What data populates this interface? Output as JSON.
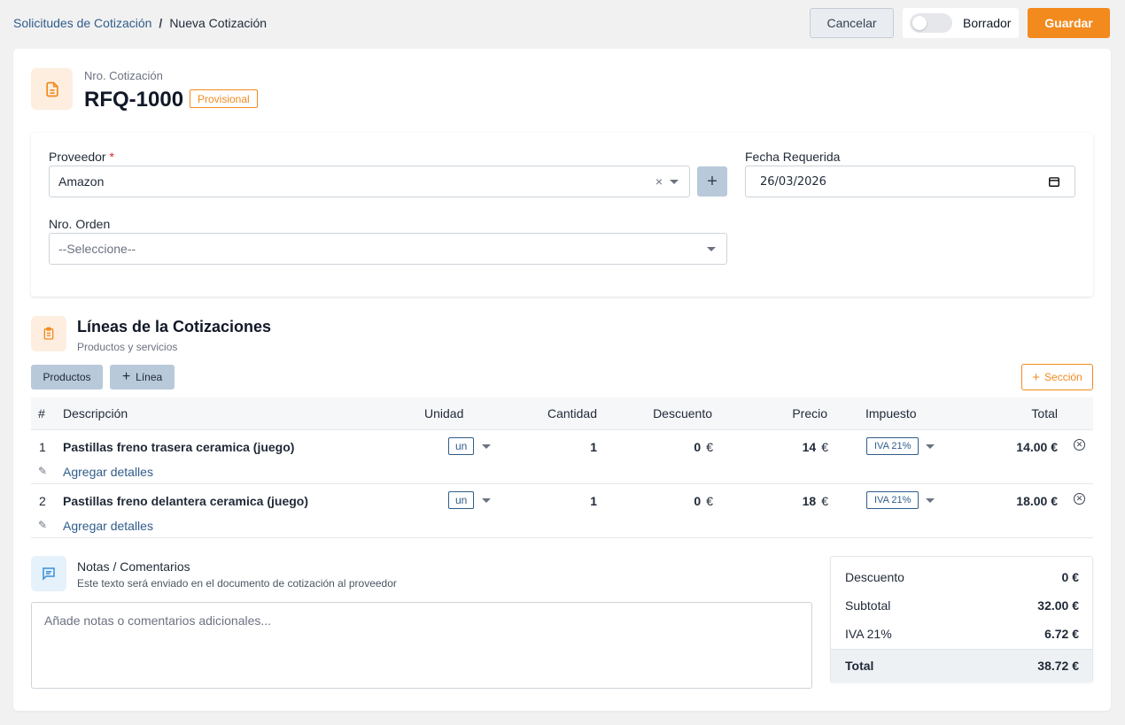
{
  "breadcrumb": {
    "parent": "Solicitudes de Cotización",
    "separator": "/",
    "current": "Nueva Cotización"
  },
  "header": {
    "cancel_label": "Cancelar",
    "draft_label": "Borrador",
    "draft_on": false,
    "save_label": "Guardar"
  },
  "quote": {
    "number_label": "Nro. Cotización",
    "number": "RFQ-1000",
    "status_badge": "Provisional"
  },
  "form": {
    "supplier_label": "Proveedor",
    "required_mark": "*",
    "supplier_value": "Amazon",
    "clear_glyph": "×",
    "add_glyph": "+",
    "date_label": "Fecha Requerida",
    "date_value": "26/03/2026",
    "order_label": "Nro. Orden",
    "order_placeholder": "--Seleccione--"
  },
  "lines": {
    "title": "Líneas de la Cotizaciones",
    "subtitle": "Productos y servicios",
    "products_label": "Productos",
    "add_line_label": "Línea",
    "add_section_label": "Sección",
    "plus_glyph": "+",
    "columns": {
      "num": "#",
      "description": "Descripción",
      "unit": "Unidad",
      "quantity": "Cantidad",
      "discount": "Descuento",
      "price": "Precio",
      "tax": "Impuesto",
      "total": "Total"
    },
    "currency": "€",
    "add_details_label": "Agregar detalles",
    "rows": [
      {
        "num": "1",
        "description": "Pastillas freno trasera ceramica (juego)",
        "unit": "un",
        "quantity": "1",
        "discount": "0",
        "price": "14",
        "tax": "IVA 21%",
        "total": "14.00 €"
      },
      {
        "num": "2",
        "description": "Pastillas freno delantera ceramica (juego)",
        "unit": "un",
        "quantity": "1",
        "discount": "0",
        "price": "18",
        "tax": "IVA 21%",
        "total": "18.00 €"
      }
    ]
  },
  "notes": {
    "title": "Notas / Comentarios",
    "subtitle": "Este texto será enviado en el documento de cotización al proveedor",
    "placeholder": "Añade notas o comentarios adicionales..."
  },
  "totals": {
    "discount_label": "Descuento",
    "discount_value": "0 €",
    "subtotal_label": "Subtotal",
    "subtotal_value": "32.00 €",
    "tax_label": "IVA 21%",
    "tax_value": "6.72 €",
    "total_label": "Total",
    "total_value": "38.72 €"
  },
  "colors": {
    "accent": "#f28a1e",
    "link": "#2f5d8a",
    "secondary_button": "#b8c9da"
  }
}
